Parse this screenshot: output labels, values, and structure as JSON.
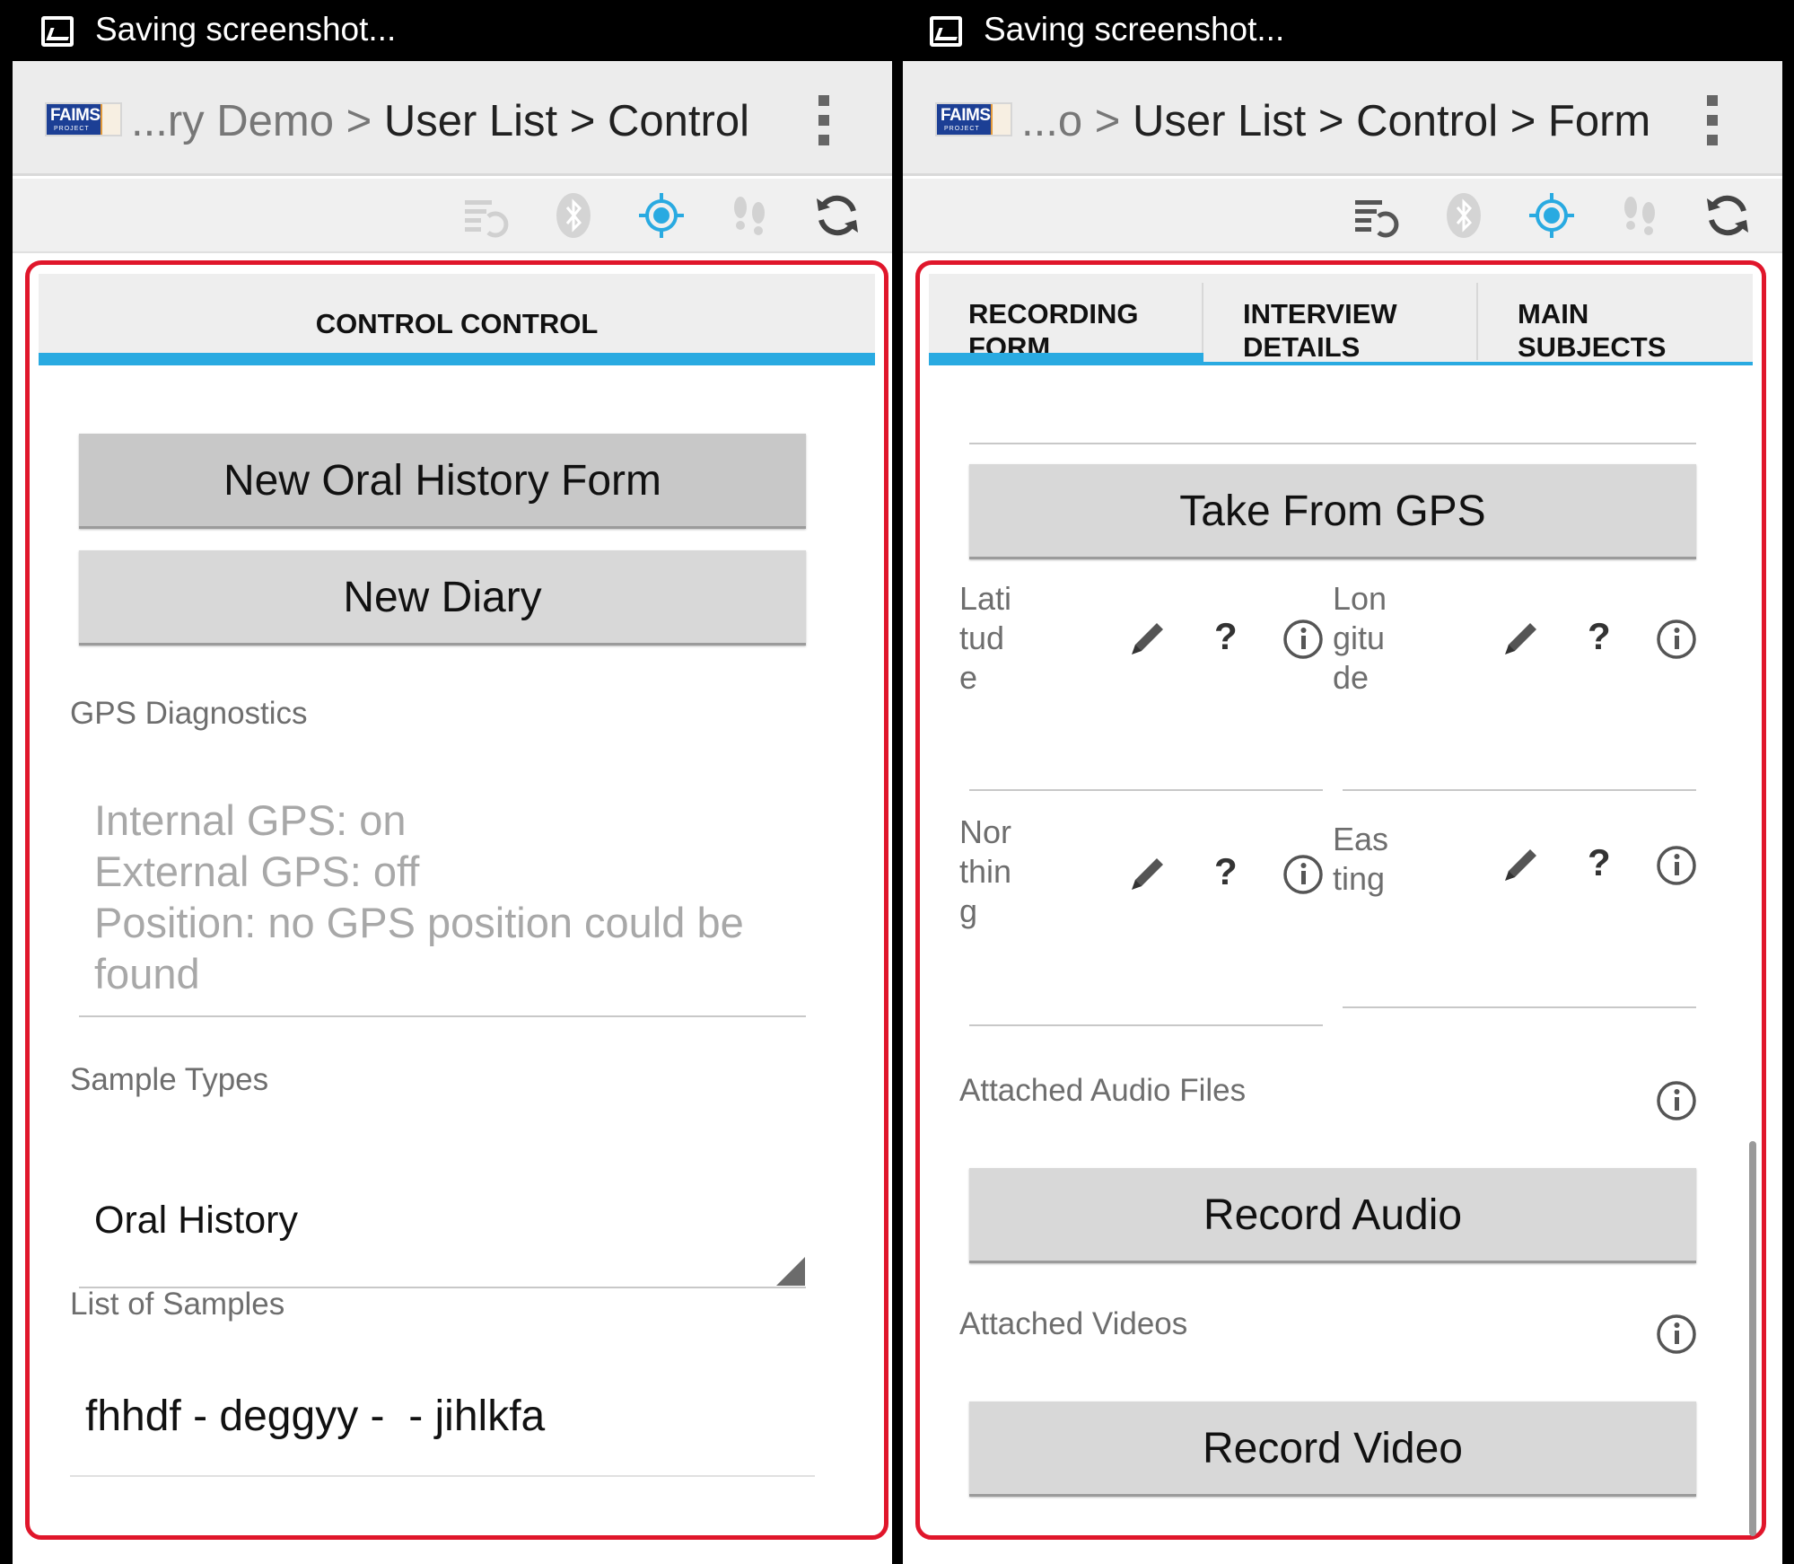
{
  "left": {
    "status": {
      "text": "Saving screenshot..."
    },
    "actionbar": {
      "logo_text": "FAIMS",
      "logo_sub": "PROJECT",
      "crumb_dim": "...ry Demo >",
      "crumb_main": "User List > Control"
    },
    "tab": {
      "label": "CONTROL CONTROL"
    },
    "buttons": {
      "new_oral_history": "New Oral History Form",
      "new_diary": "New Diary"
    },
    "gps": {
      "label": "GPS Diagnostics",
      "line1": "Internal GPS: on",
      "line2": "External GPS: off",
      "line3": "Position: no GPS position could be",
      "line4": "found"
    },
    "sample_types": {
      "label": "Sample Types",
      "value": "Oral History"
    },
    "samples": {
      "label": "List of Samples",
      "value": "fhhdf - deggyy -  - jihlkfa"
    }
  },
  "right": {
    "status": {
      "text": "Saving screenshot..."
    },
    "actionbar": {
      "logo_text": "FAIMS",
      "logo_sub": "PROJECT",
      "crumb_dim": "...o >",
      "crumb_main": "User List > Control > Form"
    },
    "tabs": [
      {
        "line1": "RECORDING",
        "line2": "FORM"
      },
      {
        "line1": "INTERVIEW",
        "line2": "DETAILS"
      },
      {
        "line1": "MAIN",
        "line2": "SUBJECTS"
      }
    ],
    "buttons": {
      "take_gps": "Take From GPS",
      "record_audio": "Record Audio",
      "record_video": "Record Video"
    },
    "fields": {
      "latitude": [
        "Lati",
        "tud",
        "e"
      ],
      "longitude": [
        "Lon",
        "gitu",
        "de"
      ],
      "northing": [
        "Nor",
        "thin",
        "g"
      ],
      "easting": [
        "Eas",
        "ting"
      ],
      "question": "?"
    },
    "attachments": {
      "audio_label": "Attached Audio Files",
      "video_label": "Attached Videos"
    }
  },
  "colors": {
    "accent": "#29aae1",
    "highlight_frame": "#e0162b",
    "logo_blue": "#1c3f95"
  },
  "icons": [
    "image-icon",
    "sync-list-icon",
    "bluetooth-icon",
    "gps-target-icon",
    "footprints-icon",
    "refresh-icon",
    "overflow-menu-icon",
    "pencil-icon",
    "help-icon",
    "info-icon",
    "dropdown-corner-icon"
  ]
}
